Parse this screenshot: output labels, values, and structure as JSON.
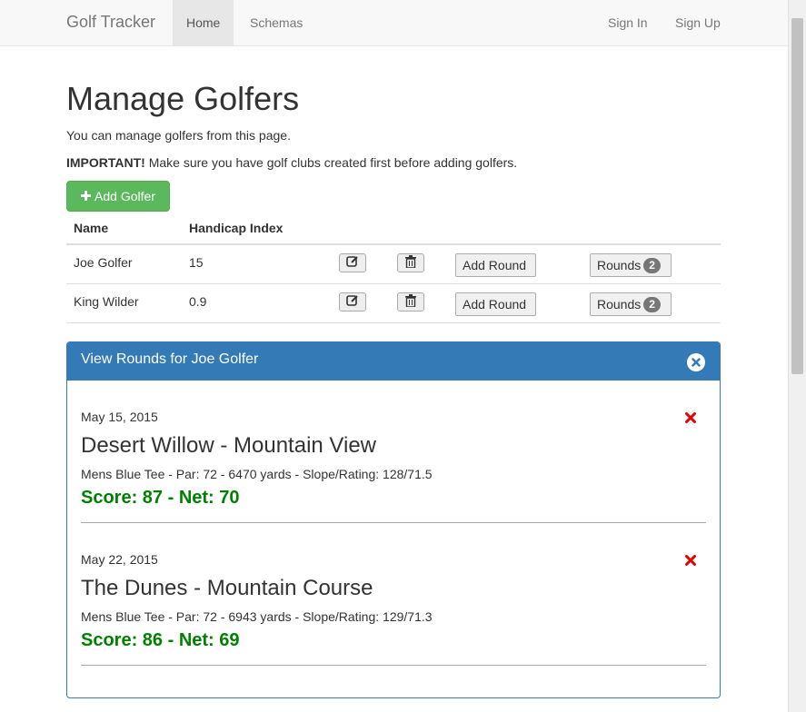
{
  "navbar": {
    "brand": "Golf Tracker",
    "links": [
      "Home",
      "Schemas"
    ],
    "right_links": [
      "Sign In",
      "Sign Up"
    ]
  },
  "page": {
    "title": "Manage Golfers",
    "intro": "You can manage golfers from this page.",
    "important_label": "IMPORTANT!",
    "important_text": " Make sure you have golf clubs created first before adding golfers.",
    "add_button": "Add Golfer"
  },
  "table": {
    "headers": [
      "Name",
      "Handicap Index"
    ],
    "rows": [
      {
        "name": "Joe Golfer",
        "handicap": "15",
        "add_round": "Add Round",
        "rounds_label": "Rounds",
        "rounds_count": "2"
      },
      {
        "name": "King Wilder",
        "handicap": "0.9",
        "add_round": "Add Round",
        "rounds_label": "Rounds",
        "rounds_count": "2"
      }
    ]
  },
  "panel": {
    "title": "View Rounds for Joe Golfer",
    "rounds": [
      {
        "date": "May 15, 2015",
        "course": "Desert Willow - Mountain View",
        "details": "Mens Blue Tee - Par: 72 - 6470 yards - Slope/Rating: 128/71.5",
        "score": "Score: 87 - Net: 70"
      },
      {
        "date": "May 22, 2015",
        "course": "The Dunes - Mountain Course",
        "details": "Mens Blue Tee - Par: 72 - 6943 yards - Slope/Rating: 129/71.3",
        "score": "Score: 86 - Net: 69"
      }
    ]
  },
  "colors": {
    "primary": "#337ab7",
    "success": "#5cb85c",
    "score_green": "#008000",
    "delete_red": "#e00000"
  }
}
